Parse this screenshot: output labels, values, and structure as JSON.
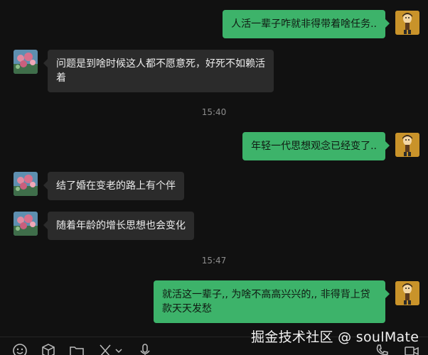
{
  "messages": [
    {
      "sender": "me",
      "text": "人活一辈子咋就非得带着啥任务.."
    },
    {
      "sender": "other",
      "text": "问题是到啥时候这人都不愿意死，好死不如赖活着"
    },
    {
      "sender": "me",
      "text": "年轻一代思想观念已经变了.."
    },
    {
      "sender": "other",
      "text": "结了婚在变老的路上有个伴"
    },
    {
      "sender": "other",
      "text": "随着年龄的增长思想也会变化"
    },
    {
      "sender": "me",
      "text": "就活这一辈子,, 为啥不高高兴兴的,, 非得背上贷款天天发愁"
    }
  ],
  "timestamps": [
    "15:40",
    "15:47"
  ],
  "watermark": "掘金技术社区 @ soulMate",
  "toolbar": {
    "icons": [
      "emoji-icon",
      "box-icon",
      "folder-icon",
      "scissors-icon",
      "chevron-down-icon",
      "microphone-icon",
      "phone-icon",
      "video-icon"
    ]
  },
  "colors": {
    "background": "#111111",
    "my_bubble": "#3db36a",
    "other_bubble": "#2b2b2b"
  }
}
